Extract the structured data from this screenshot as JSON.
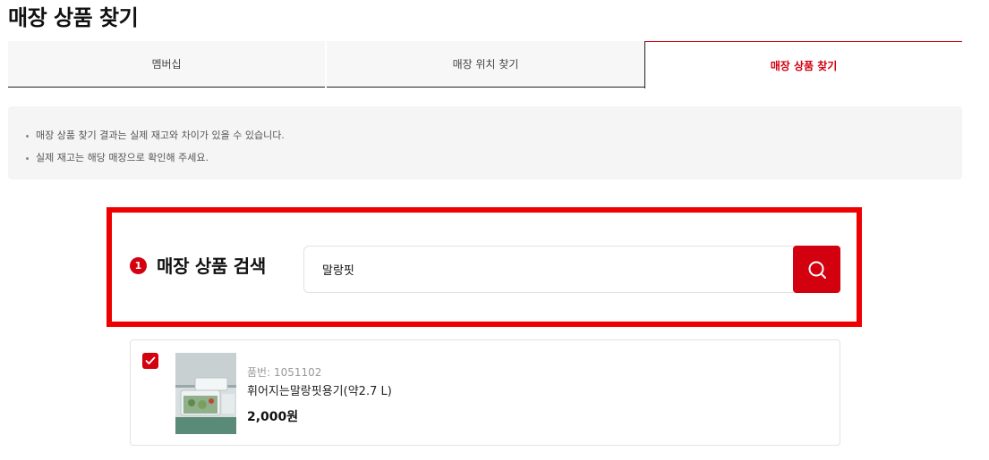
{
  "page": {
    "title": "매장 상품 찾기"
  },
  "tabs": [
    {
      "label": "멤버십",
      "active": false
    },
    {
      "label": "매장 위치 찾기",
      "active": false
    },
    {
      "label": "매장 상품 찾기",
      "active": true
    }
  ],
  "notice": {
    "items": [
      "매장 상품 찾기 결과는 실제 재고와 차이가 있을 수 있습니다.",
      "실제 재고는 해당 매장으로 확인해 주세요."
    ]
  },
  "search": {
    "step_number": "1",
    "label": "매장 상품 검색",
    "value": "말랑핏",
    "button_icon": "search-icon"
  },
  "results": [
    {
      "checked": true,
      "code_text": "품번: 1051102",
      "name": "휘어지는말랑핏용기(약2.7 L)",
      "price": "2,000원"
    }
  ],
  "colors": {
    "accent": "#d3000f",
    "highlight_border": "#ee0000",
    "notice_bg": "#f5f5f5"
  }
}
